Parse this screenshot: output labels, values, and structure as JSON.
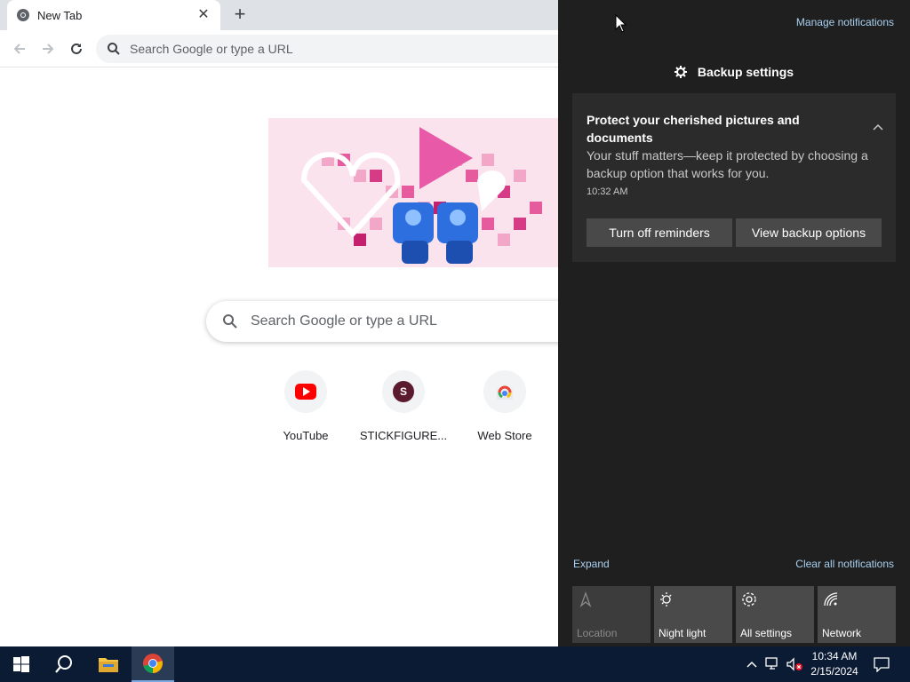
{
  "browser": {
    "tab": {
      "title": "New Tab",
      "close_glyph": "✕"
    },
    "new_tab_glyph": "+",
    "omnibox": {
      "placeholder": "Search Google or type a URL"
    },
    "ntp": {
      "search_placeholder": "Search Google or type a URL",
      "shortcuts": [
        {
          "label": "YouTube",
          "icon": "youtube-icon"
        },
        {
          "label": "STICKFIGURE...",
          "icon": "letter-s-icon",
          "letter": "S"
        },
        {
          "label": "Web Store",
          "icon": "chrome-web-store-icon"
        }
      ]
    }
  },
  "action_center": {
    "manage_notifications": "Manage notifications",
    "app_header": "Backup settings",
    "notification": {
      "title": "Protect your cherished pictures and documents",
      "body": "Your stuff matters—keep it protected by choosing a backup option that works for you.",
      "time": "10:32 AM",
      "buttons": [
        "Turn off reminders",
        "View backup options"
      ]
    },
    "expand": "Expand",
    "clear_all": "Clear all notifications",
    "quick_actions": [
      {
        "label": "Location",
        "icon": "location-icon",
        "enabled": false
      },
      {
        "label": "Night light",
        "icon": "night-light-icon",
        "enabled": true
      },
      {
        "label": "All settings",
        "icon": "gear-icon",
        "enabled": true
      },
      {
        "label": "Network",
        "icon": "network-icon",
        "enabled": true
      }
    ]
  },
  "taskbar": {
    "clock_time": "10:34 AM",
    "clock_date": "2/15/2024"
  },
  "colors": {
    "action_center_bg": "#1f1f1f",
    "notification_bg": "#2b2b2b",
    "link": "#a8d0f0",
    "taskbar_bg": "#0b1b33"
  }
}
